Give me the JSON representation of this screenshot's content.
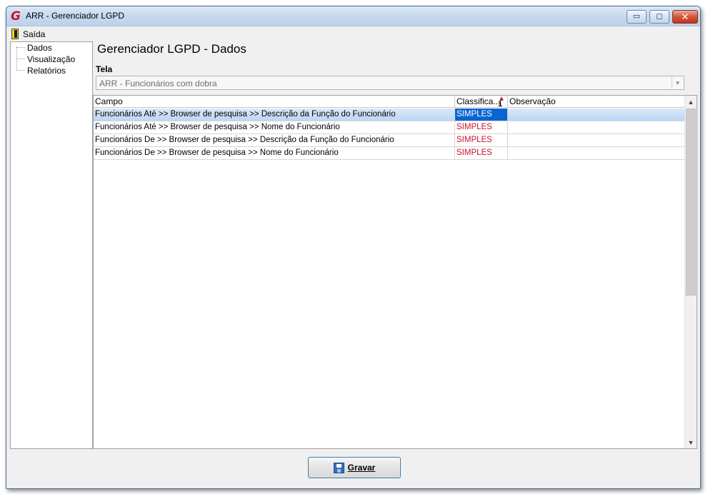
{
  "window": {
    "title": "ARR - Gerenciador LGPD",
    "logo_glyph": "G",
    "controls": {
      "minimize": "▭",
      "maximize": "◻",
      "close": "✕"
    }
  },
  "menu": {
    "exit_label": "Saída"
  },
  "nav": {
    "items": [
      {
        "label": "Dados"
      },
      {
        "label": "Visualização"
      },
      {
        "label": "Relatórios"
      }
    ]
  },
  "main": {
    "title": "Gerenciador LGPD - Dados",
    "screen_label": "Tela",
    "screen_value": "ARR - Funcionários com dobra"
  },
  "grid": {
    "columns": {
      "campo": "Campo",
      "classificacao": "Classifica...",
      "classificacao_sort_order": "1",
      "observacao": "Observação"
    },
    "rows": [
      {
        "campo": "Funcionários Até >> Browser de pesquisa >> Descrição da Função do Funcionário",
        "classificacao": "SIMPLES",
        "observacao": ""
      },
      {
        "campo": "Funcionários Até >> Browser de pesquisa >> Nome do Funcionário",
        "classificacao": "SIMPLES",
        "observacao": ""
      },
      {
        "campo": "Funcionários De >> Browser de pesquisa >> Descrição da Função do Funcionário",
        "classificacao": "SIMPLES",
        "observacao": ""
      },
      {
        "campo": "Funcionários De >> Browser de pesquisa >> Nome do Funcionário",
        "classificacao": "SIMPLES",
        "observacao": ""
      }
    ],
    "selected_row": 0
  },
  "footer": {
    "save_label": "Gravar"
  },
  "colors": {
    "accent_red": "#c8102e",
    "selection_blue": "#0a64d2",
    "button_border": "#3c7fb1"
  },
  "icons": {
    "app": "app-logo-icon",
    "exit": "exit-door-icon",
    "sort": "sort-ascending-icon",
    "save": "floppy-disk-icon",
    "combo": "chevron-down-icon"
  }
}
